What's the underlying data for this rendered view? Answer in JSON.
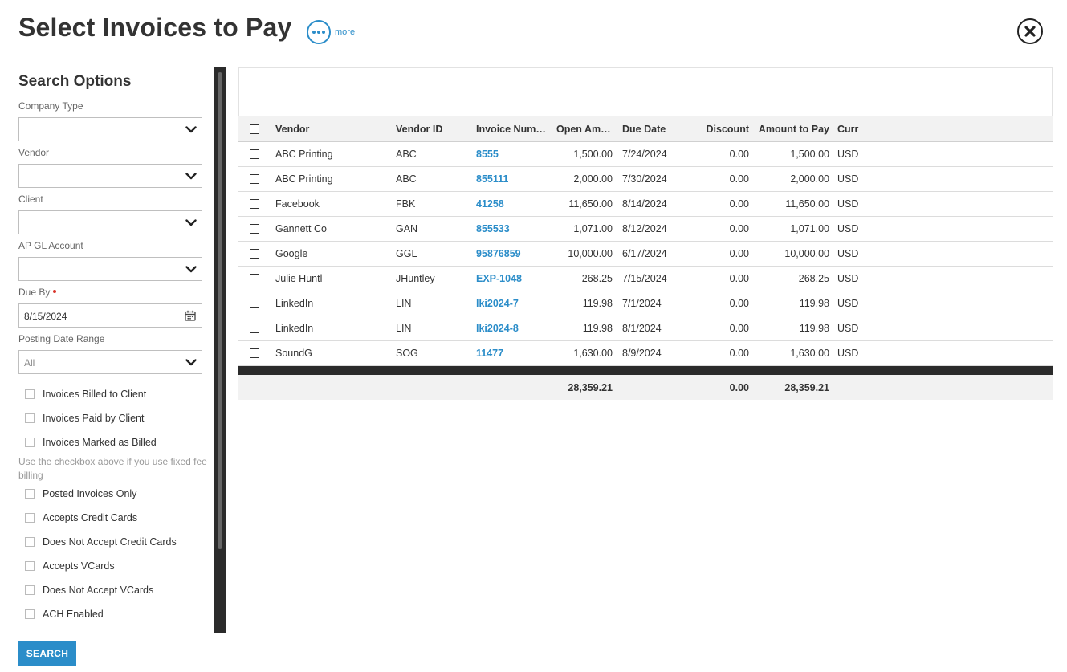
{
  "page": {
    "title": "Select Invoices to Pay",
    "more_label": "more"
  },
  "sidebar": {
    "title": "Search Options",
    "fields": {
      "company_type": {
        "label": "Company Type",
        "value": ""
      },
      "vendor": {
        "label": "Vendor",
        "value": ""
      },
      "client": {
        "label": "Client",
        "value": ""
      },
      "ap_gl_account": {
        "label": "AP GL Account",
        "value": ""
      },
      "due_by": {
        "label": "Due By",
        "value": "8/15/2024"
      },
      "posting_date_range": {
        "label": "Posting Date Range",
        "value": "All"
      }
    },
    "checkboxes_top": [
      {
        "label": "Invoices Billed to Client",
        "checked": false
      },
      {
        "label": "Invoices Paid by Client",
        "checked": false
      },
      {
        "label": "Invoices Marked as Billed",
        "checked": false
      }
    ],
    "hint": "Use the checkbox above if you use fixed fee billing",
    "checkboxes_bottom": [
      {
        "label": "Posted Invoices Only",
        "checked": false
      },
      {
        "label": "Accepts Credit Cards",
        "checked": false
      },
      {
        "label": "Does Not Accept Credit Cards",
        "checked": false
      },
      {
        "label": "Accepts VCards",
        "checked": false
      },
      {
        "label": "Does Not Accept VCards",
        "checked": false
      },
      {
        "label": "ACH Enabled",
        "checked": false
      }
    ],
    "search_label": "SEARCH"
  },
  "grid": {
    "columns": {
      "vendor": "Vendor",
      "vendor_id": "Vendor ID",
      "invoice_number": "Invoice Num…",
      "open_amount": "Open Am…",
      "due_date": "Due Date",
      "discount": "Discount",
      "amount_to_pay": "Amount to Pay",
      "currency": "Curr"
    },
    "rows": [
      {
        "vendor": "ABC Printing",
        "vendor_id": "ABC",
        "invoice_number": "8555",
        "open_amount": "1,500.00",
        "due_date": "7/24/2024",
        "discount": "0.00",
        "amount_to_pay": "1,500.00",
        "currency": "USD"
      },
      {
        "vendor": "ABC Printing",
        "vendor_id": "ABC",
        "invoice_number": "855111",
        "open_amount": "2,000.00",
        "due_date": "7/30/2024",
        "discount": "0.00",
        "amount_to_pay": "2,000.00",
        "currency": "USD"
      },
      {
        "vendor": "Facebook",
        "vendor_id": "FBK",
        "invoice_number": "41258",
        "open_amount": "11,650.00",
        "due_date": "8/14/2024",
        "discount": "0.00",
        "amount_to_pay": "11,650.00",
        "currency": "USD"
      },
      {
        "vendor": "Gannett Co",
        "vendor_id": "GAN",
        "invoice_number": "855533",
        "open_amount": "1,071.00",
        "due_date": "8/12/2024",
        "discount": "0.00",
        "amount_to_pay": "1,071.00",
        "currency": "USD"
      },
      {
        "vendor": "Google",
        "vendor_id": "GGL",
        "invoice_number": "95876859",
        "open_amount": "10,000.00",
        "due_date": "6/17/2024",
        "discount": "0.00",
        "amount_to_pay": "10,000.00",
        "currency": "USD"
      },
      {
        "vendor": "Julie Huntl",
        "vendor_id": "JHuntley",
        "invoice_number": "EXP-1048",
        "open_amount": "268.25",
        "due_date": "7/15/2024",
        "discount": "0.00",
        "amount_to_pay": "268.25",
        "currency": "USD"
      },
      {
        "vendor": "LinkedIn",
        "vendor_id": "LIN",
        "invoice_number": "lki2024-7",
        "open_amount": "119.98",
        "due_date": "7/1/2024",
        "discount": "0.00",
        "amount_to_pay": "119.98",
        "currency": "USD"
      },
      {
        "vendor": "LinkedIn",
        "vendor_id": "LIN",
        "invoice_number": "lki2024-8",
        "open_amount": "119.98",
        "due_date": "8/1/2024",
        "discount": "0.00",
        "amount_to_pay": "119.98",
        "currency": "USD"
      },
      {
        "vendor": "SoundG",
        "vendor_id": "SOG",
        "invoice_number": "11477",
        "open_amount": "1,630.00",
        "due_date": "8/9/2024",
        "discount": "0.00",
        "amount_to_pay": "1,630.00",
        "currency": "USD"
      }
    ],
    "totals": {
      "open_amount": "28,359.21",
      "discount": "0.00",
      "amount_to_pay": "28,359.21"
    }
  },
  "colors": {
    "accent": "#2b8dc9",
    "required": "#d9342b",
    "dark_bar": "#2b2b2b"
  }
}
